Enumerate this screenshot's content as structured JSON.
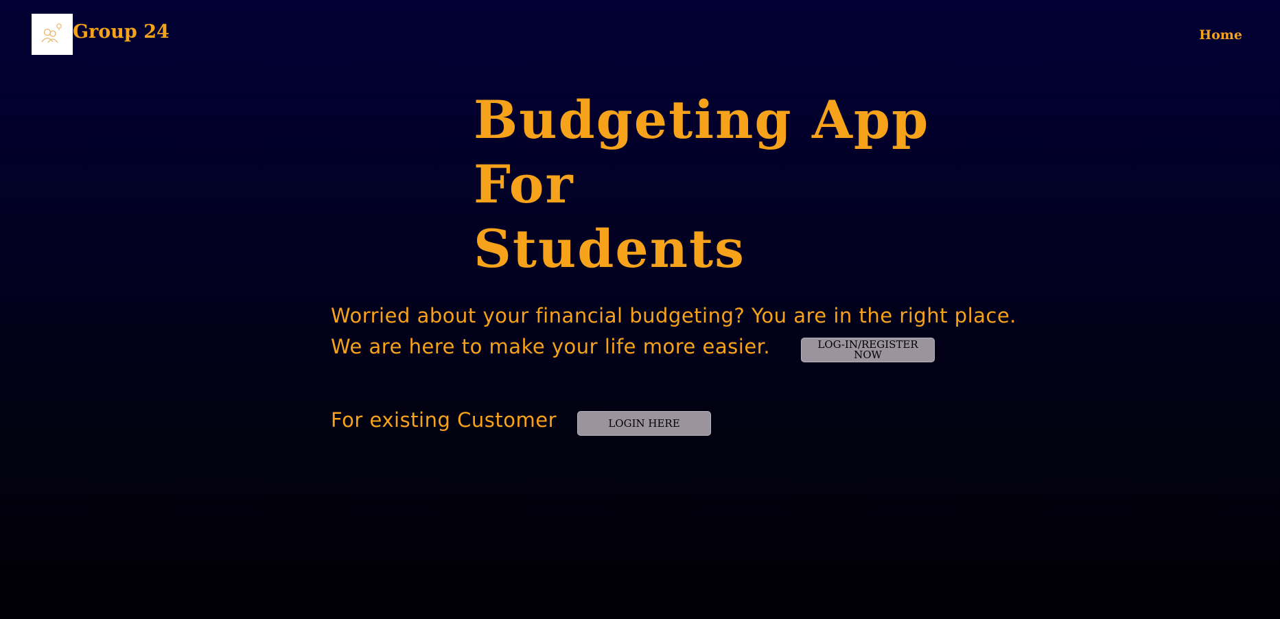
{
  "header": {
    "brand_name": "Group 24",
    "logo_icon": "people-with-idea-icon",
    "nav_home": "Home"
  },
  "hero": {
    "title": "Budgeting App\nFor\nStudents",
    "tagline_line1": "Worried about your financial budgeting? You are in the right place.",
    "tagline_line2": "We are here to make your life more easier.",
    "register_button": "LOG-IN/REGISTER NOW",
    "existing_customer_label": "For existing Customer",
    "login_button": "LOGIN HERE"
  },
  "colors": {
    "accent": "#f7a21b",
    "background_top": "#010034",
    "background_bottom": "#010006",
    "button_bg": "#9b939e"
  }
}
